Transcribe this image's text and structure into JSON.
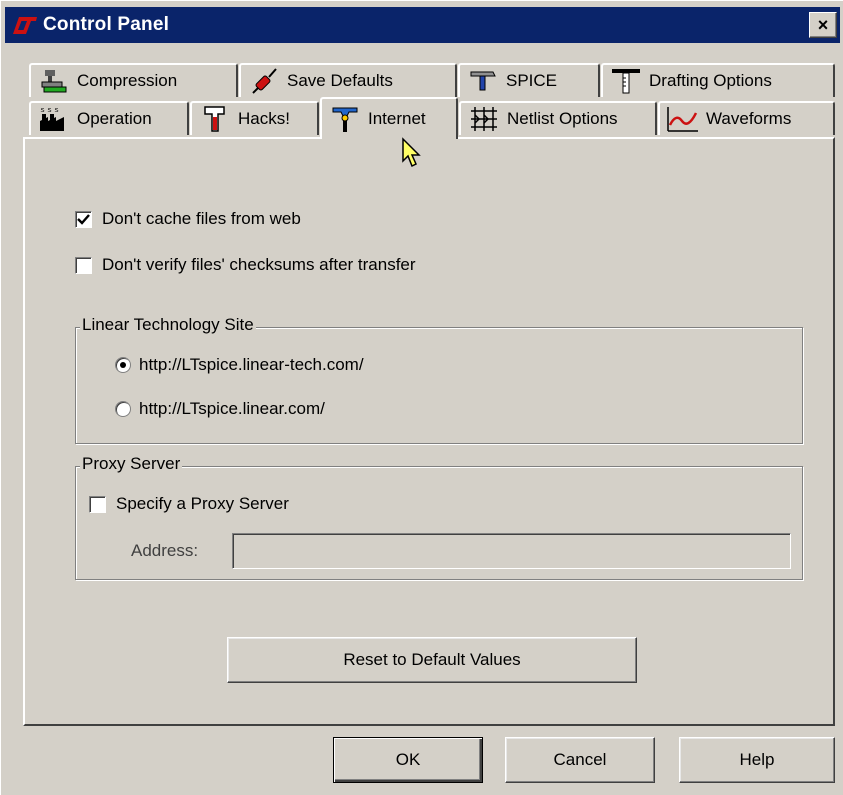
{
  "window": {
    "title": "Control Panel",
    "close_label": "×"
  },
  "tabs": {
    "row1": [
      {
        "label": "Compression",
        "icon": "compression-icon"
      },
      {
        "label": "Save Defaults",
        "icon": "save-defaults-icon"
      },
      {
        "label": "SPICE",
        "icon": "spice-hammer-icon"
      },
      {
        "label": "Drafting Options",
        "icon": "drafting-icon"
      }
    ],
    "row2": [
      {
        "label": "Operation",
        "icon": "factory-icon"
      },
      {
        "label": "Hacks!",
        "icon": "hacks-icon"
      },
      {
        "label": "Internet",
        "icon": "internet-icon",
        "active": true
      },
      {
        "label": "Netlist Options",
        "icon": "netlist-icon"
      },
      {
        "label": "Waveforms",
        "icon": "waveform-icon"
      }
    ]
  },
  "internet": {
    "dont_cache": {
      "label": "Don't cache files from web",
      "checked": true
    },
    "dont_verify": {
      "label": "Don't verify files' checksums after transfer",
      "checked": false
    },
    "site_group": {
      "label": "Linear Technology Site",
      "options": [
        {
          "label": "http://LTspice.linear-tech.com/",
          "selected": true
        },
        {
          "label": "http://LTspice.linear.com/",
          "selected": false
        }
      ]
    },
    "proxy_group": {
      "label": "Proxy Server",
      "specify": {
        "label": "Specify a Proxy Server",
        "checked": false
      },
      "address_label": "Address:",
      "address_value": ""
    },
    "reset_label": "Reset to Default Values"
  },
  "buttons": {
    "ok": "OK",
    "cancel": "Cancel",
    "help": "Help"
  },
  "colors": {
    "titlebar": "#0a246a",
    "face": "#d4d0c8",
    "logo_red": "#cc1111"
  }
}
